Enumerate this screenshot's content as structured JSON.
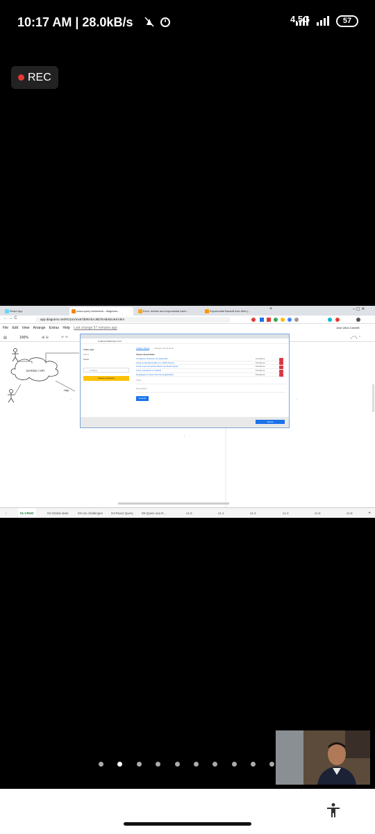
{
  "status_bar": {
    "time": "10:17 AM | 28.0kB/s",
    "network": "4.5G",
    "battery": "57"
  },
  "recording": {
    "label": "REC"
  },
  "browser": {
    "tabs": [
      {
        "label": "React App",
        "color": "#61dafb"
      },
      {
        "label": "react-query-tirulimaria - diagrams...",
        "color": "#f08705",
        "active": true
      },
      {
        "label": "Error, entries and exponential back...",
        "color": "#f5a623"
      },
      {
        "label": "Exponential Backoff And Jitter |...",
        "color": "#ff9900"
      }
    ],
    "url": "app.diagrams.net/#G1ixVmx67d5RAbAJ6b7kABmEoKKV8m",
    "profile": "Jose Ulloa Cardelli"
  },
  "drawio": {
    "menu": [
      "File",
      "Edit",
      "View",
      "Arrange",
      "Extras",
      "Help"
    ],
    "last_change": "Last change 57 minutes ago",
    "zoom": "100%",
    "diagram": {
      "cloud_label": "DATOS / API",
      "http_label": "Http"
    },
    "sheets": [
      "01-CRUD",
      "02-Global state",
      "03-csv challenges",
      "04-React Query",
      "05-Quien usa R...",
      "v1.0",
      "v1.1",
      "v1.2",
      "v1.3",
      "v1.6",
      "v1.8"
    ]
  },
  "inner_app": {
    "url": "localhost:3000/index.html",
    "sidebar": {
      "title": "Todos App",
      "subtitle": "Filtros",
      "section": "Todos",
      "input_placeholder": "Id Tarea",
      "button": "Tareas pendientes"
    },
    "tabs": [
      "Listado Tareas",
      "Agregar nueva tarea"
    ],
    "list_title": "Tareas disponibles",
    "tasks": [
      {
        "title": "Configurar ambiente de desarrollo",
        "status": "Pendiente"
      },
      {
        "title": "Crear un Endpoint fake con JSON Server",
        "status": "Pendiente"
      },
      {
        "title": "Crear nuevo proyecto React con React Query",
        "status": "Pendiente"
      },
      {
        "title": "Crear repositorio en Github",
        "status": "Pendiente"
      },
      {
        "title": "Desplegar el nuevo front de la aplicación",
        "status": "Pendiente"
      }
    ],
    "title_field": "Titulo",
    "desc_field": "Descripción",
    "save_button": "Guardar",
    "footer_button": "Tareas"
  },
  "pager": {
    "count": 10,
    "active": 1
  },
  "colors": {
    "accent": "#1a73e8",
    "danger": "#dc3545",
    "warning": "#ffc107"
  }
}
